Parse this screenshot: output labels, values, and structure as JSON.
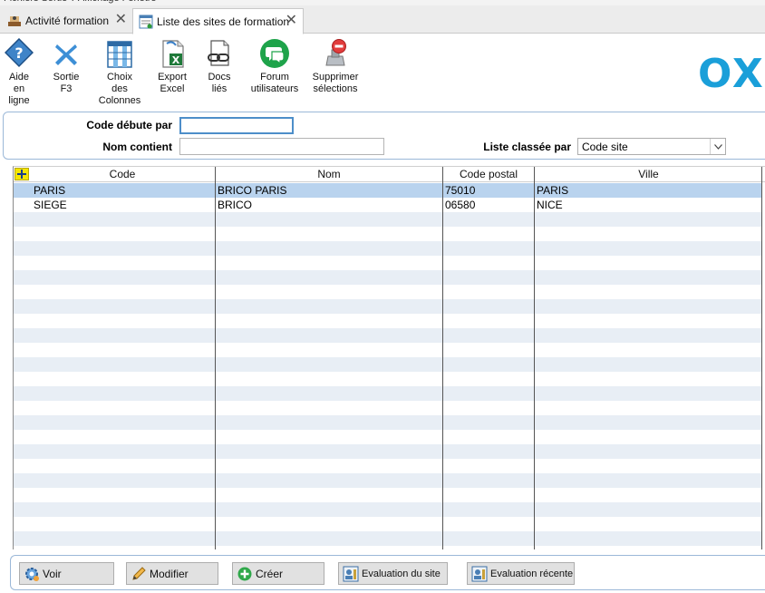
{
  "tabs": [
    {
      "label": "Activité formation",
      "active": false
    },
    {
      "label": "Liste des sites de formation",
      "active": true
    }
  ],
  "toolbar": [
    {
      "label": "Aide\nen\nligne",
      "icon": "help-icon"
    },
    {
      "label": "Sortie\nF3",
      "icon": "close-x-icon"
    },
    {
      "label": "Choix\ndes\nColonnes",
      "icon": "columns-icon"
    },
    {
      "label": "Export\nExcel",
      "icon": "excel-icon"
    },
    {
      "label": "Docs\nliés",
      "icon": "linked-docs-icon"
    },
    {
      "label": "Forum\nutilisateurs",
      "icon": "forum-icon"
    },
    {
      "label": "Supprimer\nsélections",
      "icon": "delete-selection-icon"
    }
  ],
  "logo_text": "OX",
  "filters": {
    "code_label": "Code débute par",
    "code_value": "",
    "nom_label": "Nom contient",
    "nom_value": "",
    "sort_label": "Liste classée par",
    "sort_value": "Code site"
  },
  "grid": {
    "columns": [
      "Code",
      "Nom",
      "Code postal",
      "Ville"
    ],
    "rows": [
      [
        "PARIS",
        "BRICO PARIS",
        "75010",
        "PARIS"
      ],
      [
        "SIEGE",
        "BRICO",
        "06580",
        "NICE"
      ]
    ],
    "selected_row": 0
  },
  "actions": [
    {
      "label": "Voir",
      "icon": "view-gear-icon"
    },
    {
      "label": "Modifier",
      "icon": "pencil-icon"
    },
    {
      "label": "Créer",
      "icon": "plus-circle-icon"
    },
    {
      "label": "Evaluation du site",
      "icon": "evaluation-icon"
    },
    {
      "label": "Evaluation récente",
      "icon": "evaluation-icon"
    }
  ],
  "colors": {
    "accent": "#1a9fd9",
    "selected_row": "#b9d3ee",
    "alt_row": "#e8eef5",
    "panel_border": "#9bb8d8"
  }
}
